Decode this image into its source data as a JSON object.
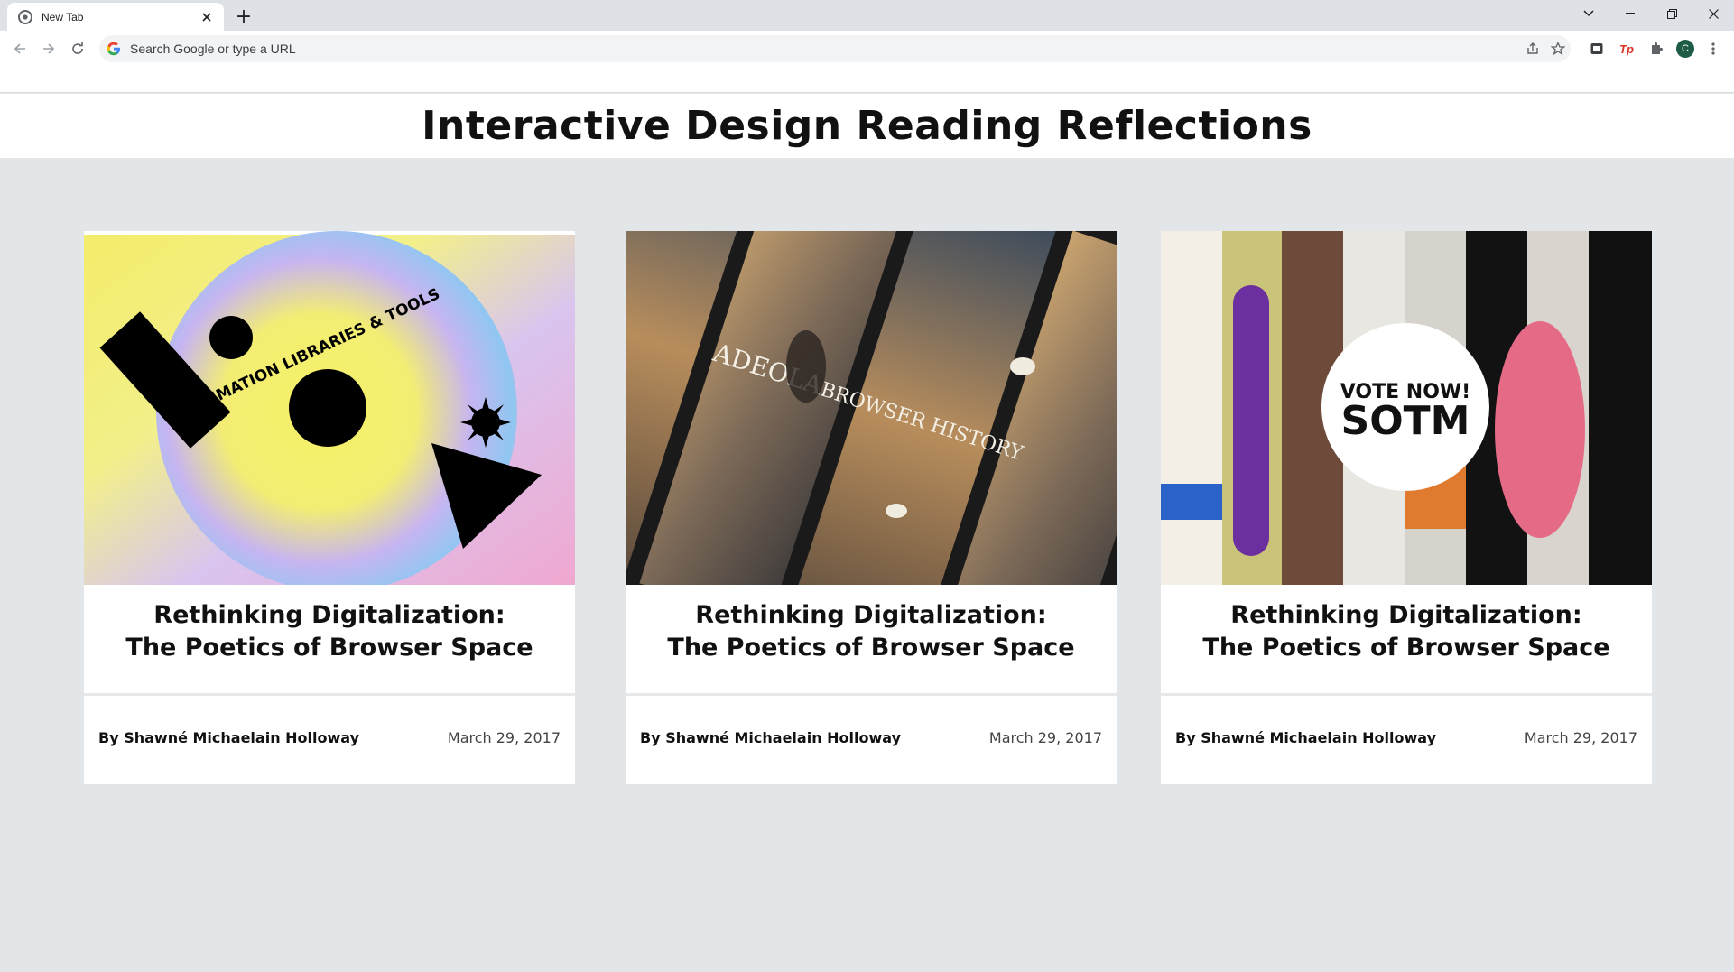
{
  "browser": {
    "tab_title": "New Tab",
    "new_tab": "+",
    "omnibox_placeholder": "Search Google or type a URL",
    "profile_initial": "C",
    "ext_tp_label": "Tp"
  },
  "page": {
    "title": "Interactive Design Reading Reflections"
  },
  "cards": [
    {
      "title_line1": "Rethinking Digitalization:",
      "title_line2": "The Poetics of Browser Space",
      "author": "By Shawné Michaelain Holloway",
      "date": "March 29, 2017",
      "image_text": "UI ANIMATION LIBRARIES & TOOLS"
    },
    {
      "title_line1": "Rethinking Digitalization:",
      "title_line2": "The Poetics of Browser Space",
      "author": "By Shawné Michaelain Holloway",
      "date": "March 29, 2017",
      "image_text_1": "ADEOLA",
      "image_text_2": "BROWSER HISTORY"
    },
    {
      "title_line1": "Rethinking Digitalization:",
      "title_line2": "The Poetics of Browser Space",
      "author": "By Shawné Michaelain Holloway",
      "date": "March 29, 2017",
      "image_text_1": "VOTE NOW!",
      "image_text_2": "SOTM"
    }
  ],
  "colors": {
    "page_bg": "#e3e6e8",
    "chrome_bg": "#dee1e6",
    "card_bg": "#ffffff"
  }
}
